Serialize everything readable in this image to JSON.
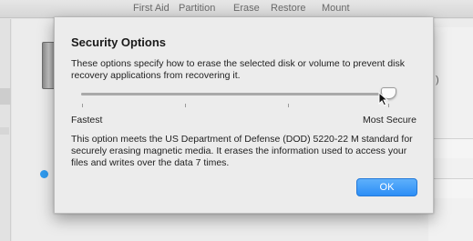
{
  "toolbar": {
    "first_aid": "First Aid",
    "partition": "Partition",
    "erase": "Erase",
    "restore": "Restore",
    "mount": "Mount"
  },
  "background": {
    "right_fragment": ")"
  },
  "dialog": {
    "title": "Security Options",
    "description": "These options specify how to erase the selected disk or volume to prevent disk recovery applications from recovering it.",
    "slider": {
      "min_label": "Fastest",
      "max_label": "Most Secure",
      "value_fraction": 1.0
    },
    "info": "This option meets the US Department of Defense (DOD) 5220-22 M standard for securely erasing magnetic media. It erases the information used to access your files and writes over the data 7 times.",
    "ok_label": "OK"
  },
  "colors": {
    "accent": "#2c8ef6",
    "sheet_bg": "#ececec"
  }
}
